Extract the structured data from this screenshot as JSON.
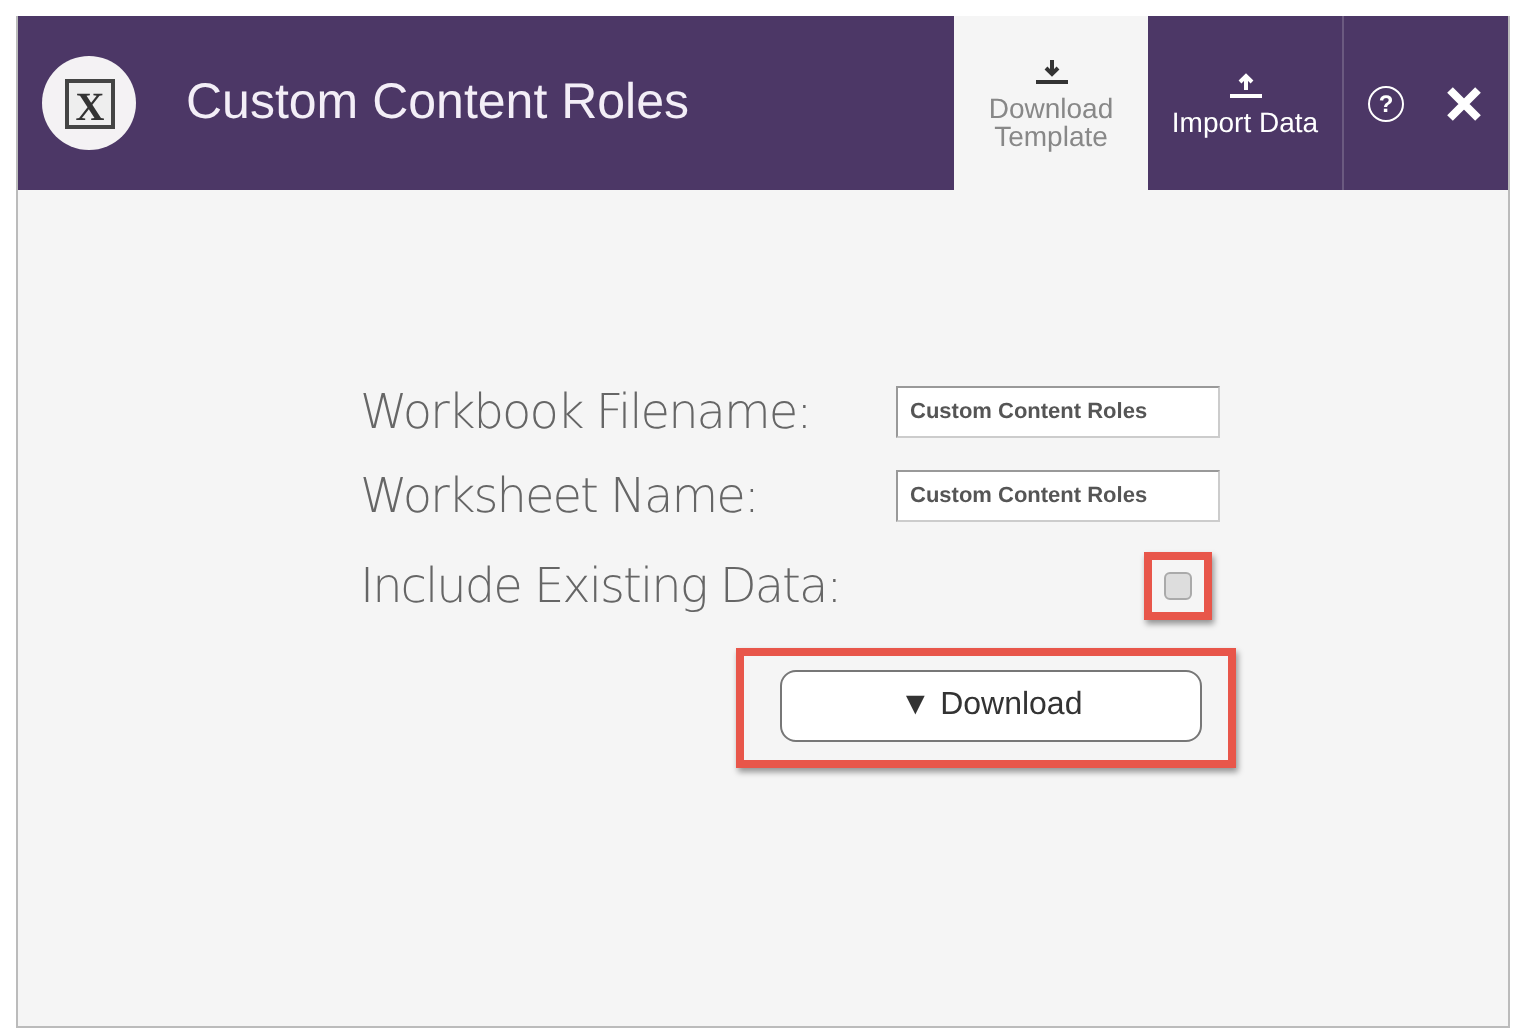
{
  "window": {
    "logo_text": "X",
    "title": "Custom Content Roles"
  },
  "tabs": [
    {
      "label": "Download Template",
      "kind": "download",
      "selected": true
    },
    {
      "label": "Import Data",
      "kind": "upload",
      "selected": false
    }
  ],
  "header_icons": [
    {
      "kind": "help",
      "label": "?"
    },
    {
      "kind": "close"
    }
  ],
  "form": {
    "fields": [
      {
        "label": "Workbook Filename:",
        "value": "Custom Content Roles"
      },
      {
        "label": "Worksheet Name:",
        "value": "Custom Content Roles"
      }
    ],
    "include_existing": {
      "label": "Include Existing Data:",
      "checked": false,
      "highlighted": true
    },
    "download_button": {
      "label": "▼ Download",
      "highlighted": true
    }
  }
}
